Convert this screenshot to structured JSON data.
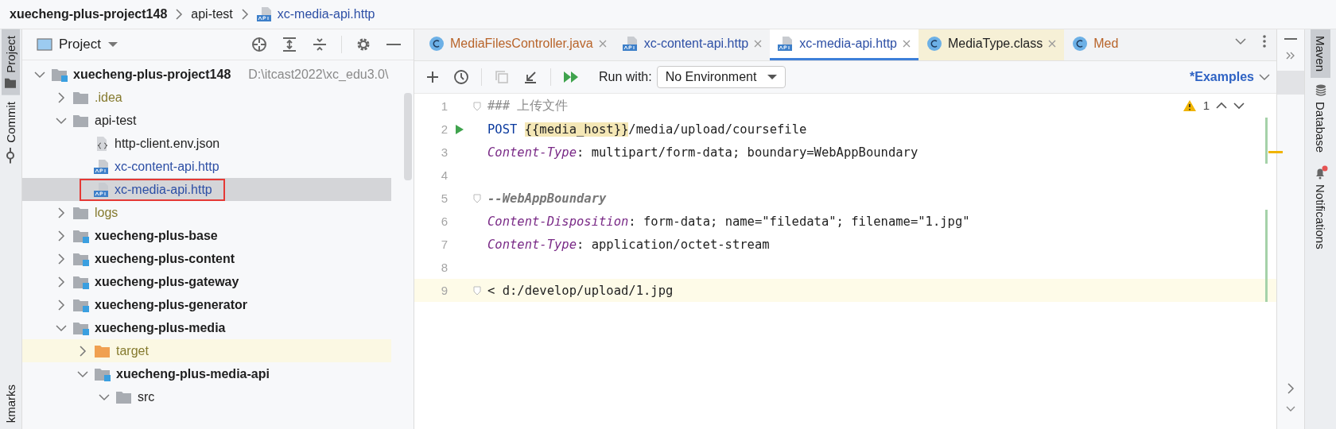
{
  "breadcrumb": [
    {
      "label": "xuecheng-plus-project148",
      "kind": "project"
    },
    {
      "label": "api-test",
      "kind": "folder"
    },
    {
      "label": "xc-media-api.http",
      "kind": "http"
    }
  ],
  "left_strip": [
    {
      "label": "Project",
      "kind": "project",
      "selected": true
    },
    {
      "label": "Commit",
      "kind": "commit",
      "selected": false
    },
    {
      "label": "kmarks",
      "kind": "bookmarks",
      "selected": false
    }
  ],
  "project_panel": {
    "title": "Project",
    "tree": [
      {
        "label": "xuecheng-plus-project148",
        "kind": "module",
        "path": "D:\\itcast2022\\xc_edu3.0\\",
        "expanded": true,
        "selected": false,
        "ignored": false,
        "highlighted": false,
        "children": [
          {
            "label": ".idea",
            "kind": "folder",
            "expanded": false,
            "selected": false,
            "ignored": true,
            "highlighted": false
          },
          {
            "label": "api-test",
            "kind": "folder",
            "expanded": true,
            "selected": false,
            "ignored": false,
            "highlighted": false,
            "children": [
              {
                "label": "http-client.env.json",
                "kind": "json",
                "selected": false,
                "ignored": false,
                "highlighted": false
              },
              {
                "label": "xc-content-api.http",
                "kind": "http",
                "selected": false,
                "ignored": false,
                "highlighted": false
              },
              {
                "label": "xc-media-api.http",
                "kind": "http",
                "selected": true,
                "ignored": false,
                "highlighted": true
              }
            ]
          },
          {
            "label": "logs",
            "kind": "folder",
            "expanded": false,
            "selected": false,
            "ignored": true,
            "highlighted": false
          },
          {
            "label": "xuecheng-plus-base",
            "kind": "module",
            "expanded": false,
            "selected": false,
            "ignored": false,
            "highlighted": false
          },
          {
            "label": "xuecheng-plus-content",
            "kind": "module",
            "expanded": false,
            "selected": false,
            "ignored": false,
            "highlighted": false
          },
          {
            "label": "xuecheng-plus-gateway",
            "kind": "module",
            "expanded": false,
            "selected": false,
            "ignored": false,
            "highlighted": false
          },
          {
            "label": "xuecheng-plus-generator",
            "kind": "module",
            "expanded": false,
            "selected": false,
            "ignored": false,
            "highlighted": false
          },
          {
            "label": "xuecheng-plus-media",
            "kind": "module",
            "expanded": true,
            "selected": false,
            "ignored": false,
            "highlighted": false,
            "children": [
              {
                "label": "target",
                "kind": "excluded-folder",
                "expanded": false,
                "selected": false,
                "ignored": true,
                "highlighted": false
              },
              {
                "label": "xuecheng-plus-media-api",
                "kind": "module",
                "expanded": true,
                "selected": false,
                "ignored": false,
                "highlighted": false,
                "children": [
                  {
                    "label": "src",
                    "kind": "folder",
                    "expanded": true,
                    "selected": false,
                    "ignored": false,
                    "highlighted": false
                  }
                ]
              }
            ]
          }
        ]
      }
    ]
  },
  "tabs": [
    {
      "label": "MediaFilesController.java",
      "kind": "class",
      "color": "#b8642a",
      "selected": false,
      "closable": true
    },
    {
      "label": "xc-content-api.http",
      "kind": "http",
      "color": "#2d4fa5",
      "selected": false,
      "closable": true
    },
    {
      "label": "xc-media-api.http",
      "kind": "http",
      "color": "#2d4fa5",
      "selected": true,
      "closable": true
    },
    {
      "label": "MediaType.class",
      "kind": "library-class",
      "color": "#222222",
      "selected": false,
      "closable": true
    },
    {
      "label": "Med",
      "kind": "class",
      "color": "#b8642a",
      "selected": false,
      "closable": false
    }
  ],
  "toolbar": {
    "run_with_label": "Run with:",
    "environment": "No Environment",
    "examples": "*Examples"
  },
  "editor": {
    "warning_count": "1",
    "lines": [
      {
        "number": "1",
        "run": false,
        "fold": true,
        "current": false,
        "changed": false,
        "warning_stripe": false,
        "tokens": [
          {
            "text": "### 上传文件",
            "kind": "comment"
          }
        ]
      },
      {
        "number": "2",
        "run": true,
        "fold": false,
        "current": false,
        "changed": true,
        "warning_stripe": false,
        "tokens": [
          {
            "text": "POST ",
            "kind": "method"
          },
          {
            "text": "{{media_host}}",
            "kind": "variable"
          },
          {
            "text": "/media/upload/coursefile",
            "kind": "url"
          }
        ]
      },
      {
        "number": "3",
        "run": false,
        "fold": false,
        "current": false,
        "changed": true,
        "warning_stripe": true,
        "tokens": [
          {
            "text": "Content-Type",
            "kind": "header"
          },
          {
            "text": ": multipart/form-data; boundary=WebAppBoundary",
            "kind": "plain"
          }
        ]
      },
      {
        "number": "4",
        "run": false,
        "fold": false,
        "current": false,
        "changed": false,
        "warning_stripe": false
      },
      {
        "number": "5",
        "run": false,
        "fold": true,
        "current": false,
        "changed": false,
        "warning_stripe": false,
        "tokens": [
          {
            "text": "--WebAppBoundary",
            "kind": "boundary"
          }
        ]
      },
      {
        "number": "6",
        "run": false,
        "fold": false,
        "current": false,
        "changed": true,
        "warning_stripe": false,
        "tokens": [
          {
            "text": "Content-Disposition",
            "kind": "header"
          },
          {
            "text": ": form-data; name=\"filedata\"; filename=\"1.jpg\"",
            "kind": "plain"
          }
        ]
      },
      {
        "number": "7",
        "run": false,
        "fold": false,
        "current": false,
        "changed": true,
        "warning_stripe": false,
        "tokens": [
          {
            "text": "Content-Type",
            "kind": "header"
          },
          {
            "text": ": application/octet-stream",
            "kind": "plain"
          }
        ]
      },
      {
        "number": "8",
        "run": false,
        "fold": false,
        "current": false,
        "changed": true,
        "warning_stripe": false
      },
      {
        "number": "9",
        "run": false,
        "fold": true,
        "current": true,
        "changed": true,
        "warning_stripe": false,
        "tokens": [
          {
            "text": "< d:/develop/upload/1.jpg",
            "kind": "plain"
          }
        ]
      }
    ]
  },
  "right_strip": [
    {
      "label": "Maven",
      "kind": "maven",
      "selected": true
    },
    {
      "label": "Database",
      "kind": "database",
      "selected": false
    },
    {
      "label": "Notifications",
      "kind": "bell",
      "selected": false,
      "badge": true
    }
  ]
}
